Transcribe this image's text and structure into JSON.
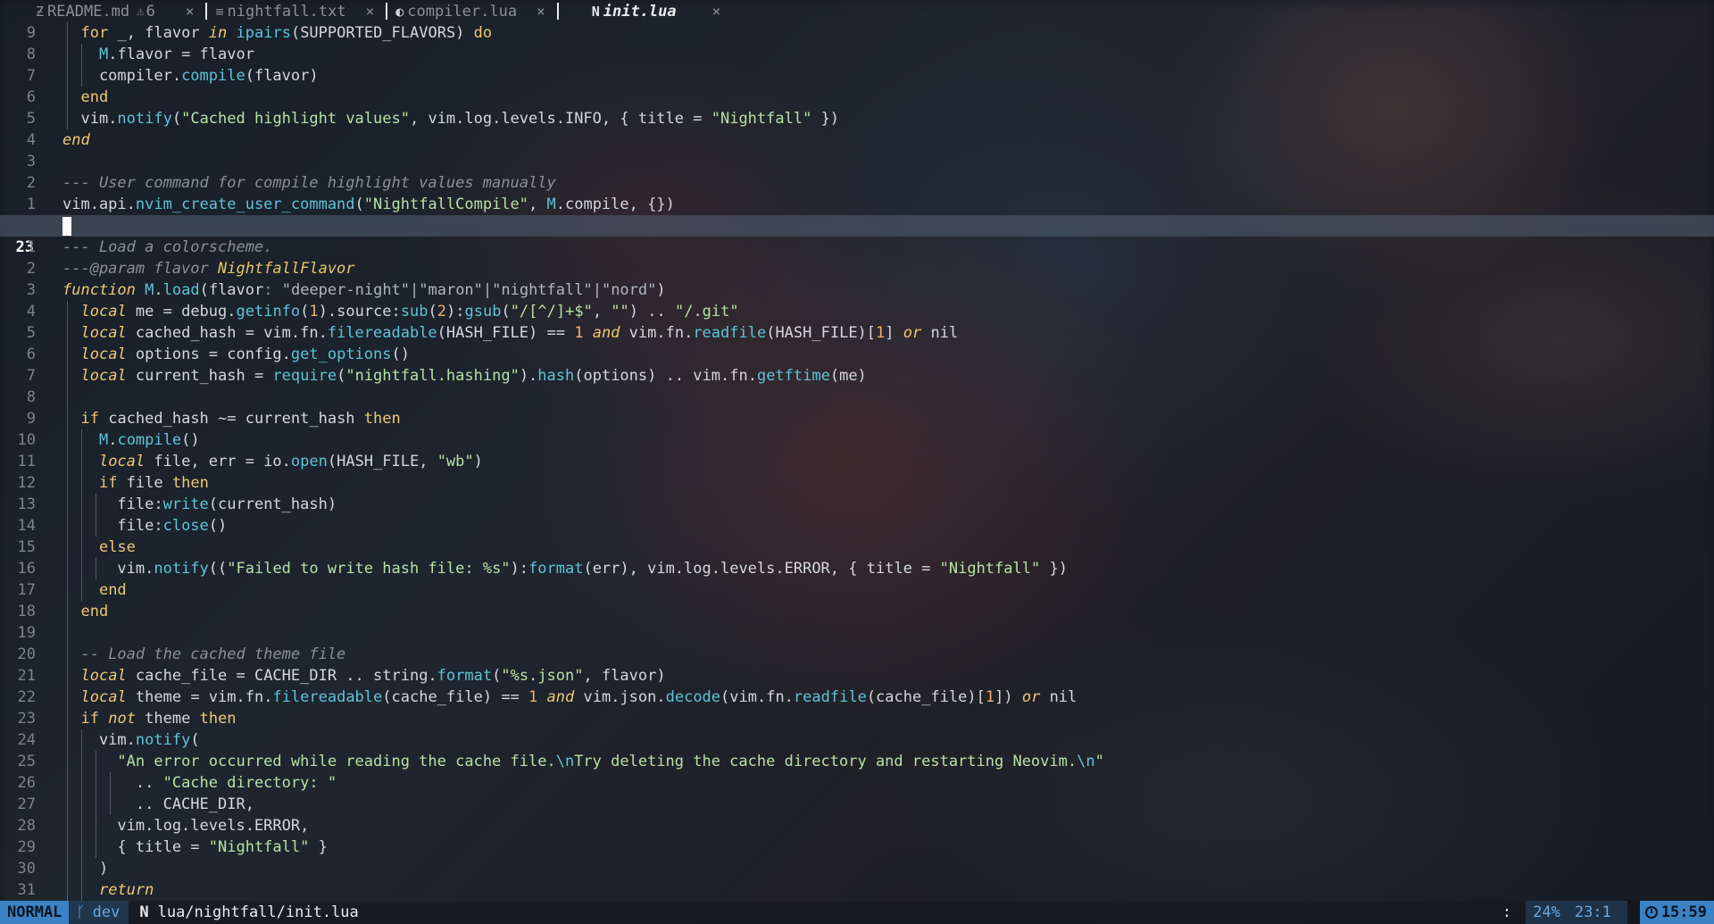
{
  "tabs": [
    {
      "icon": "Ƶ",
      "name": "README.md",
      "warnings": "6",
      "active": false
    },
    {
      "icon": "≡",
      "name": "nightfall.txt",
      "active": false
    },
    {
      "icon": "◐",
      "name": "compiler.lua",
      "active": false
    },
    {
      "icon": "N",
      "name": "init.lua",
      "active": true
    }
  ],
  "tab_close": "×",
  "warn_icon": "⚠",
  "editor": {
    "cursor_line_number": "23",
    "lines_above": [
      {
        "n": "9",
        "html": "  <span class='kw2'>for</span> _, flavor <span class='kw'>in</span> <span class='fn'>ipairs</span>(SUPPORTED_FLAVORS) <span class='kw2'>do</span>",
        "guides": [
          75
        ]
      },
      {
        "n": "8",
        "html": "    <span class='mod'>M</span>.flavor = flavor",
        "guides": [
          75,
          91
        ]
      },
      {
        "n": "7",
        "html": "    compiler.<span class='fn'>compile</span>(flavor)",
        "guides": [
          75,
          91
        ]
      },
      {
        "n": "6",
        "html": "  <span class='kw2'>end</span>",
        "guides": [
          75
        ]
      },
      {
        "n": "5",
        "html": "  vim.<span class='fn'>notify</span>(<span class='str'>\"Cached highlight values\"</span>, vim.log.levels.INFO, { title = <span class='str'>\"Nightfall\"</span> })",
        "guides": [
          75
        ]
      },
      {
        "n": "4",
        "html": "<span class='kw'>end</span>",
        "guides": []
      },
      {
        "n": "3",
        "html": "",
        "guides": []
      },
      {
        "n": "2",
        "html": "<span class='cm'>--- User command for compile highlight values manually</span>",
        "guides": []
      },
      {
        "n": "1",
        "html": "vim.api.<span class='fn'>nvim_create_user_command</span>(<span class='str'>\"NightfallCompile\"</span>, <span class='mod'>M</span>.compile, {})",
        "guides": []
      }
    ],
    "lines_below": [
      {
        "n": "1",
        "html": "<span class='cm'>--- Load a colorscheme.</span>",
        "guides": []
      },
      {
        "n": "2",
        "html": "<span class='cm'>---@param flavor </span><span class='ty'>NightfallFlavor</span>",
        "guides": []
      },
      {
        "n": "3",
        "html": "<span class='kw'>function</span> <span class='mod'>M</span>.<span class='fn'>load</span>(flavor<span class='cm' style='font-style:normal'>: </span><span class='str' style='color:#b0b6be'>\"deeper-night\"|\"maron\"|\"nightfall\"|\"nord\"</span>)",
        "guides": []
      },
      {
        "n": "4",
        "html": "  <span class='kw'>local</span> me = debug.<span class='fn'>getinfo</span>(<span class='num'>1</span>).source:<span class='fn'>sub</span>(<span class='num'>2</span>):<span class='fn'>gsub</span>(<span class='str'>\"/[^/]+$\"</span>, <span class='str'>\"\"</span>) .. <span class='str'>\"/.git\"</span>",
        "guides": [
          75
        ]
      },
      {
        "n": "5",
        "html": "  <span class='kw'>local</span> cached_hash = vim.fn.<span class='fn'>filereadable</span>(HASH_FILE) == <span class='num'>1</span> <span class='kw'>and</span> vim.fn.<span class='fn'>readfile</span>(HASH_FILE)[<span class='num'>1</span>] <span class='kw'>or</span> nil",
        "guides": [
          75
        ]
      },
      {
        "n": "6",
        "html": "  <span class='kw'>local</span> options = config.<span class='fn'>get_options</span>()",
        "guides": [
          75
        ]
      },
      {
        "n": "7",
        "html": "  <span class='kw'>local</span> current_hash = <span class='fn'>require</span>(<span class='str'>\"nightfall.hashing\"</span>).<span class='fn'>hash</span>(options) .. vim.fn.<span class='fn'>getftime</span>(me)",
        "guides": [
          75
        ]
      },
      {
        "n": "8",
        "html": "",
        "guides": [
          75
        ]
      },
      {
        "n": "9",
        "html": "  <span class='kw2'>if</span> cached_hash ~= current_hash <span class='kw2'>then</span>",
        "guides": [
          75
        ]
      },
      {
        "n": "10",
        "html": "    <span class='mod'>M</span>.<span class='fn'>compile</span>()",
        "guides": [
          75,
          91
        ]
      },
      {
        "n": "11",
        "html": "    <span class='kw'>local</span> file, err = io.<span class='fn'>open</span>(HASH_FILE, <span class='str'>\"wb\"</span>)",
        "guides": [
          75,
          91
        ]
      },
      {
        "n": "12",
        "html": "    <span class='kw2'>if</span> file <span class='kw2'>then</span>",
        "guides": [
          75,
          91
        ]
      },
      {
        "n": "13",
        "html": "      file:<span class='fn'>write</span>(current_hash)",
        "guides": [
          75,
          91,
          107
        ]
      },
      {
        "n": "14",
        "html": "      file:<span class='fn'>close</span>()",
        "guides": [
          75,
          91,
          107
        ]
      },
      {
        "n": "15",
        "html": "    <span class='kw2'>else</span>",
        "guides": [
          75,
          91
        ]
      },
      {
        "n": "16",
        "html": "      vim.<span class='fn'>notify</span>((<span class='str'>\"Failed to write hash file: %s\"</span>):<span class='fn'>format</span>(err), vim.log.levels.ERROR, { title = <span class='str'>\"Nightfall\"</span> })",
        "guides": [
          75,
          91,
          107
        ]
      },
      {
        "n": "17",
        "html": "    <span class='kw2'>end</span>",
        "guides": [
          75,
          91
        ]
      },
      {
        "n": "18",
        "html": "  <span class='kw2'>end</span>",
        "guides": [
          75
        ]
      },
      {
        "n": "19",
        "html": "",
        "guides": [
          75
        ]
      },
      {
        "n": "20",
        "html": "  <span class='cm'>-- Load the cached theme file</span>",
        "guides": [
          75
        ]
      },
      {
        "n": "21",
        "html": "  <span class='kw'>local</span> cache_file = CACHE_DIR .. string.<span class='fn'>format</span>(<span class='str'>\"%s.json\"</span>, flavor)",
        "guides": [
          75
        ]
      },
      {
        "n": "22",
        "html": "  <span class='kw'>local</span> theme = vim.fn.<span class='fn'>filereadable</span>(cache_file) == <span class='num'>1</span> <span class='kw'>and</span> vim.json.<span class='fn'>decode</span>(vim.fn.<span class='fn'>readfile</span>(cache_file)[<span class='num'>1</span>]) <span class='kw'>or</span> nil",
        "guides": [
          75
        ]
      },
      {
        "n": "23",
        "html": "  <span class='kw2'>if</span> <span class='kw'>not</span> theme <span class='kw2'>then</span>",
        "guides": [
          75
        ]
      },
      {
        "n": "24",
        "html": "    vim.<span class='fn'>notify</span>(",
        "guides": [
          75,
          91
        ]
      },
      {
        "n": "25",
        "html": "      <span class='str'>\"An error occurred while reading the cache file.<span class='esc'>\\n</span>Try deleting the cache directory and restarting Neovim.<span class='esc'>\\n</span>\"</span>",
        "guides": [
          75,
          91,
          107
        ]
      },
      {
        "n": "26",
        "html": "        .. <span class='str'>\"Cache directory: \"</span>",
        "guides": [
          75,
          91,
          107,
          123
        ]
      },
      {
        "n": "27",
        "html": "        .. CACHE_DIR,",
        "guides": [
          75,
          91,
          107,
          123
        ]
      },
      {
        "n": "28",
        "html": "      vim.log.levels.ERROR,",
        "guides": [
          75,
          91,
          107
        ]
      },
      {
        "n": "29",
        "html": "      { title = <span class='str'>\"Nightfall\"</span> }",
        "guides": [
          75,
          91,
          107
        ]
      },
      {
        "n": "30",
        "html": "    )",
        "guides": [
          75,
          91
        ]
      },
      {
        "n": "31",
        "html": "    <span class='kw'>return</span>",
        "guides": [
          75,
          91
        ]
      }
    ]
  },
  "statusline": {
    "mode": "NORMAL",
    "branch_icon": "ᚴ",
    "branch": "dev",
    "file_icon": "N",
    "file_path": "lua/nightfall/init.lua",
    "colon": ":",
    "percent": "24%",
    "position": "23:1",
    "time": "15:59"
  },
  "colors": {
    "accent": "#3b82c4",
    "keyword": "#f0c674",
    "function": "#5fc3d7",
    "string": "#b8e0a4",
    "comment": "#8a8f98"
  }
}
